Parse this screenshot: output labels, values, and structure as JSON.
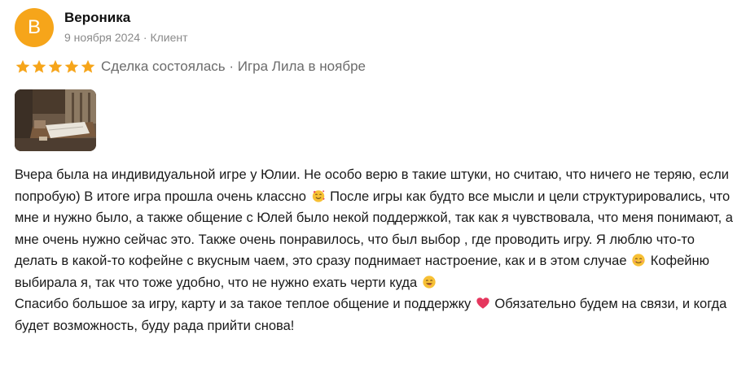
{
  "review": {
    "author": {
      "initial": "В",
      "name": "Вероника",
      "meta": "9 ноября 2024 · Клиент",
      "avatar_color": "#f6a51a"
    },
    "rating": {
      "stars": 5,
      "star_color": "#f6a51a",
      "deal_text": "Сделка состоялась · Игра Лила в ноябре"
    },
    "photo": {
      "icon": "review-photo-thumbnail"
    },
    "paragraph1": {
      "part1": "Вчера была на индивидуальной игре у Юлии. Не особо верю в такие штуки, но считаю, что ничего не теряю, если попробую) В итоге игра прошла очень классно",
      "part2": " После игры как будто все мысли и цели структурировались, что мне и нужно было, а также общение с Юлей было некой поддержкой, так как я чувствовала, что меня понимают, а мне очень нужно сейчас это. Также очень понравилось, что был выбор , где проводить игру. Я люблю что-то делать в какой-то кофейне с вкусным чаем, это сразу поднимает настроение, как и в этом случае",
      "part3": " Кофейню выбирала я, так что тоже удобно, что не нужно ехать черти куда"
    },
    "paragraph2": {
      "part1": "Спасибо большое за игру, карту и за такое теплое общение и поддержку",
      "part2": " Обязательно будем на связи, и когда будет возможность, буду рада прийти снова!"
    },
    "emojis": {
      "e1": "smiling-face-with-hearts-icon",
      "e2": "smiling-face-icon",
      "e3": "face-savoring-food-icon",
      "e4": "red-heart-icon"
    }
  }
}
